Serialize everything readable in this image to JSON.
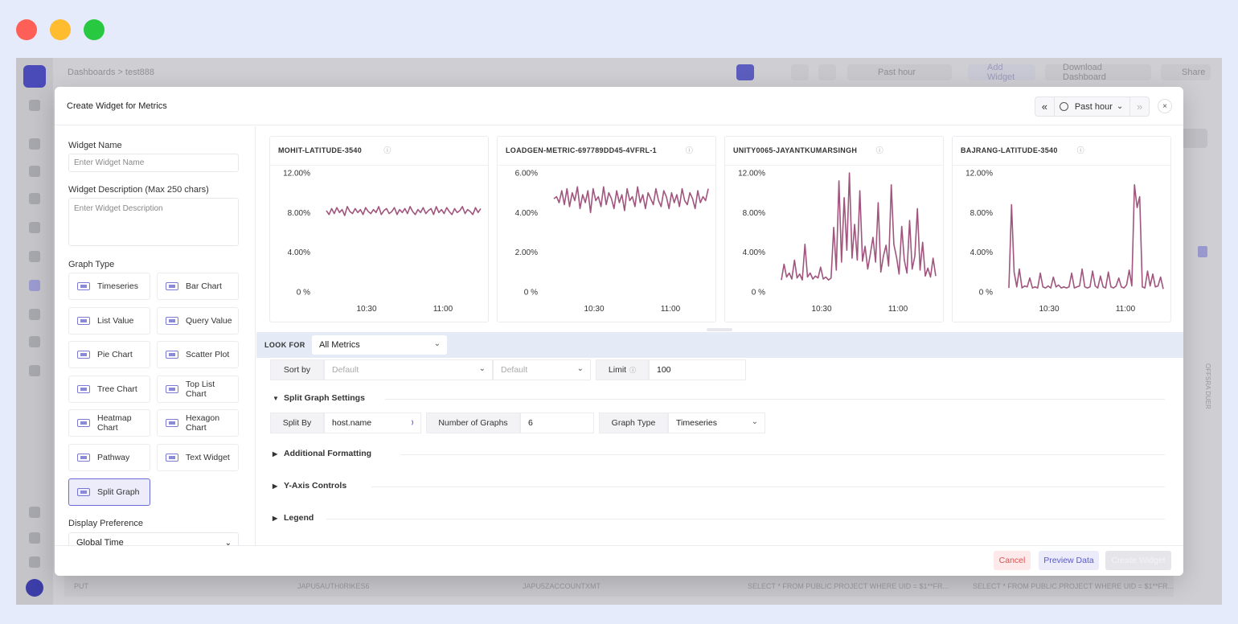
{
  "window_controls": {
    "colors": [
      "#fe5f57",
      "#febc2e",
      "#28c840"
    ]
  },
  "dashboard": {
    "breadcrumb_root": "Dashboards",
    "breadcrumb_sep": ">",
    "breadcrumb_current": "test888",
    "time_label": "Past hour",
    "add_widget": "Add Widget",
    "download": "Download Dashboard",
    "share": "Share",
    "row_cells": [
      "PUT",
      "JAPU5AUTH0RIKES6",
      "JAPU5ZACCOUNTXMT",
      "SELECT * FROM PUBLIC.PROJECT WHERE UID = $1**FR...",
      "SELECT * FROM PUBLIC.PROJECT WHERE UID = $1**FR..."
    ],
    "side_label": "OFFSRA DUER"
  },
  "modal": {
    "title": "Create Widget for Metrics",
    "time": {
      "prev": "«",
      "label": "Past hour",
      "caret": "⌄",
      "next": "»"
    },
    "close": "×",
    "widget_name": {
      "label": "Widget Name",
      "placeholder": "Enter Widget Name"
    },
    "widget_desc": {
      "label": "Widget Description (Max 250 chars)",
      "placeholder": "Enter Widget Description"
    },
    "graph_type_label": "Graph Type",
    "graph_types": [
      {
        "label": "Timeseries",
        "icon": "timeseries-icon"
      },
      {
        "label": "Bar Chart",
        "icon": "bar-chart-icon"
      },
      {
        "label": "List Value",
        "icon": "list-value-icon"
      },
      {
        "label": "Query Value",
        "icon": "query-value-icon"
      },
      {
        "label": "Pie Chart",
        "icon": "pie-chart-icon"
      },
      {
        "label": "Scatter Plot",
        "icon": "scatter-plot-icon"
      },
      {
        "label": "Tree Chart",
        "icon": "tree-chart-icon"
      },
      {
        "label": "Top List\nChart",
        "icon": "top-list-icon"
      },
      {
        "label": "Heatmap\nChart",
        "icon": "heatmap-icon"
      },
      {
        "label": "Hexagon\nChart",
        "icon": "hexagon-icon"
      },
      {
        "label": "Pathway",
        "icon": "pathway-icon"
      },
      {
        "label": "Text Widget",
        "icon": "text-widget-icon"
      },
      {
        "label": "Split Graph",
        "icon": "split-graph-icon",
        "selected": true
      }
    ],
    "display_pref": {
      "label": "Display Preference",
      "value": "Global Time"
    },
    "look_for": {
      "label": "LOOK FOR",
      "value": "All Metrics"
    },
    "sort_by": {
      "label": "Sort by",
      "value": "Default",
      "order": "Default"
    },
    "limit": {
      "label": "Limit",
      "value": "100"
    },
    "split_settings": {
      "title": "Split Graph Settings",
      "split_by_label": "Split By",
      "split_by_value": "host.name",
      "num_graphs_label": "Number of Graphs",
      "num_graphs_value": "6",
      "graph_type_label": "Graph Type",
      "graph_type_value": "Timeseries"
    },
    "sections": [
      "Additional Formatting",
      "Y-Axis Controls",
      "Legend"
    ],
    "footer": {
      "cancel": "Cancel",
      "preview": "Preview Data",
      "create": "Create Widget"
    }
  },
  "chart_data": [
    {
      "type": "line",
      "title": "MOHIT-LATITUDE-3540",
      "y_ticks": [
        "12.00%",
        "8.00%",
        "4.00%",
        "0 %"
      ],
      "ylim": [
        0,
        12
      ],
      "x_ticks": [
        "10:30",
        "11:00"
      ],
      "color": "#a0557e",
      "series": [
        {
          "values": [
            8.2,
            7.8,
            8.4,
            7.9,
            8.5,
            8.0,
            8.3,
            7.7,
            8.6,
            8.1,
            7.9,
            8.4,
            8.0,
            8.3,
            7.8,
            8.5,
            8.1,
            7.9,
            8.3,
            8.0,
            8.6,
            7.8,
            8.2,
            8.4,
            7.9,
            8.1,
            8.5,
            7.8,
            8.3,
            8.0,
            8.4,
            7.9,
            8.6,
            8.1,
            7.8,
            8.3,
            8.0,
            8.5,
            7.9,
            8.2,
            8.4,
            7.8,
            8.6,
            8.0,
            8.3,
            7.9,
            8.5,
            8.1,
            7.8,
            8.4,
            8.0,
            8.2,
            8.6,
            7.9,
            8.3,
            8.1,
            7.8,
            8.5,
            8.0,
            8.4
          ]
        }
      ]
    },
    {
      "type": "line",
      "title": "LOADGEN-METRIC-697789DD45-4VFRL-1",
      "y_ticks": [
        "6.00%",
        "4.00%",
        "2.00%",
        "0 %"
      ],
      "ylim": [
        0,
        6
      ],
      "x_ticks": [
        "10:30",
        "11:00"
      ],
      "color": "#a0557e",
      "series": [
        {
          "values": [
            4.7,
            4.8,
            4.5,
            5.1,
            4.4,
            5.2,
            4.3,
            5.0,
            4.6,
            5.3,
            4.2,
            4.9,
            4.5,
            5.1,
            4.0,
            5.2,
            4.6,
            4.8,
            4.3,
            5.3,
            4.4,
            5.0,
            4.7,
            4.2,
            5.1,
            4.5,
            4.9,
            4.1,
            5.2,
            4.6,
            4.8,
            4.3,
            5.3,
            4.5,
            4.9,
            4.2,
            5.0,
            4.7,
            4.4,
            5.2,
            4.6,
            4.3,
            5.1,
            4.8,
            4.2,
            5.0,
            4.5,
            4.9,
            4.3,
            5.2,
            4.6,
            4.4,
            5.0,
            4.7,
            4.2,
            5.1,
            4.5,
            4.8,
            4.6,
            5.2
          ]
        }
      ]
    },
    {
      "type": "line",
      "title": "UNITY0065-JAYANTKUMARSINGH",
      "y_ticks": [
        "12.00%",
        "8.00%",
        "4.00%",
        "0 %"
      ],
      "ylim": [
        0,
        12
      ],
      "x_ticks": [
        "10:30",
        "11:00"
      ],
      "color": "#a0557e",
      "series": [
        {
          "values": [
            1.2,
            2.8,
            1.5,
            1.9,
            1.3,
            3.2,
            1.4,
            1.8,
            1.2,
            4.8,
            1.5,
            1.9,
            1.3,
            1.6,
            1.4,
            2.5,
            1.3,
            1.5,
            1.2,
            1.4,
            6.5,
            2.2,
            11.2,
            3.0,
            9.5,
            4.2,
            12.0,
            3.4,
            6.8,
            3.2,
            10.2,
            3.1,
            4.6,
            2.3,
            3.8,
            5.5,
            3.0,
            9.0,
            2.0,
            3.6,
            4.7,
            2.6,
            10.8,
            4.8,
            3.5,
            1.8,
            6.6,
            3.2,
            1.9,
            7.2,
            2.3,
            3.6,
            8.4,
            2.2,
            5.0,
            1.6,
            2.4,
            1.5,
            3.4,
            1.6
          ]
        }
      ]
    },
    {
      "type": "line",
      "title": "BAJRANG-LATITUDE-3540",
      "y_ticks": [
        "12.00%",
        "8.00%",
        "4.00%",
        "0 %"
      ],
      "ylim": [
        0,
        12
      ],
      "x_ticks": [
        "10:30",
        "11:00"
      ],
      "color": "#a0557e",
      "series": [
        {
          "values": [
            0.4,
            8.8,
            2.0,
            0.5,
            2.3,
            0.4,
            0.6,
            0.5,
            1.4,
            0.4,
            0.5,
            0.4,
            1.9,
            0.5,
            0.4,
            0.6,
            0.4,
            1.5,
            0.5,
            0.7,
            0.4,
            0.5,
            0.4,
            0.5,
            1.9,
            0.4,
            0.5,
            0.6,
            2.3,
            0.5,
            0.4,
            0.5,
            2.1,
            0.6,
            0.4,
            1.6,
            0.5,
            0.4,
            2.0,
            0.5,
            0.4,
            0.6,
            1.4,
            0.5,
            0.4,
            0.7,
            2.2,
            0.6,
            10.8,
            8.5,
            9.6,
            0.5,
            0.4,
            2.1,
            0.6,
            1.8,
            0.5,
            0.6,
            1.5,
            0.3
          ]
        }
      ]
    }
  ]
}
